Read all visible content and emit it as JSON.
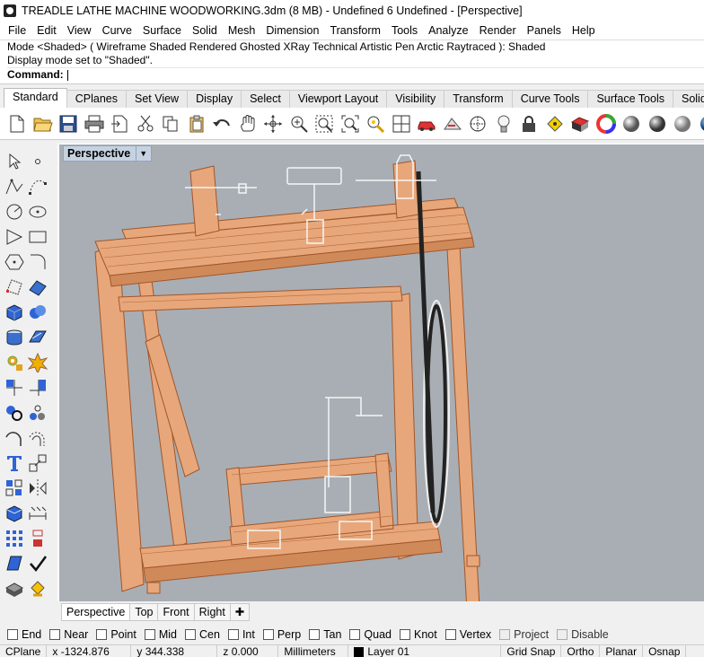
{
  "window": {
    "title": "TREADLE LATHE MACHINE WOODWORKING.3dm (8 MB) - Undefined 6 Undefined - [Perspective]"
  },
  "menu": [
    "File",
    "Edit",
    "View",
    "Curve",
    "Surface",
    "Solid",
    "Mesh",
    "Dimension",
    "Transform",
    "Tools",
    "Analyze",
    "Render",
    "Panels",
    "Help"
  ],
  "command_history": {
    "line1": "Mode <Shaded> ( Wireframe  Shaded  Rendered  Ghosted  XRay  Technical  Artistic  Pen  Arctic  Raytraced ): Shaded",
    "line2": "Display mode set to \"Shaded\".",
    "prompt_label": "Command:",
    "prompt_value": ""
  },
  "toolbar_tabs": [
    "Standard",
    "CPlanes",
    "Set View",
    "Display",
    "Select",
    "Viewport Layout",
    "Visibility",
    "Transform",
    "Curve Tools",
    "Surface Tools",
    "Solid To"
  ],
  "toolbar_tabs_active": "Standard",
  "toolbar_icons": [
    "new-icon",
    "open-icon",
    "save-icon",
    "print-icon",
    "import-icon",
    "cut-icon",
    "copy-icon",
    "paste-icon",
    "undo-icon",
    "pan-icon",
    "rotate-view-icon",
    "zoom-dynamic-icon",
    "zoom-window-icon",
    "zoom-extents-icon",
    "zoom-selected-icon",
    "four-viewports-icon",
    "car-object-icon",
    "named-views-icon",
    "cplane-icon",
    "light-icon",
    "lock-icon",
    "show-hide-icon",
    "materials-icon",
    "color-wheel-icon",
    "render-sphere-icon",
    "shaded-sphere-icon",
    "rendered-sphere-icon",
    "blue-sphere-icon"
  ],
  "left_toolbar_icons": [
    "select-arrow-icon",
    "point-icon",
    "polyline-icon",
    "curve-points-icon",
    "circle-icon",
    "ellipse-icon",
    "arc-icon",
    "rectangle-icon",
    "polygon-icon",
    "fillet-curve-icon",
    "surface-points-icon",
    "surface-edge-icon",
    "box-solid-icon",
    "boolean-union-icon",
    "cylinder-icon",
    "extrude-surface-icon",
    "gear-transform-icon",
    "explode-icon",
    "trim-icon",
    "split-icon",
    "group-icon",
    "points-on-icon",
    "curve-fillet-icon",
    "offset-curve-icon",
    "text-icon",
    "scale-icon",
    "array-icon",
    "mirror-icon",
    "solid-box-icon",
    "dimension-icon",
    "grid-array-icon",
    "block-icon",
    "surface-analysis-icon",
    "check-icon",
    "render-object-icon",
    "paint-bucket-icon"
  ],
  "viewport": {
    "label": "Perspective",
    "colors": {
      "background": "#a9aeb4",
      "wood": "#e8a77a",
      "wood_edge": "#a0562a"
    }
  },
  "view_tabs": [
    "Perspective",
    "Top",
    "Front",
    "Right"
  ],
  "view_tabs_active": "Perspective",
  "osnaps": [
    {
      "label": "End",
      "checked": false,
      "disabled": false
    },
    {
      "label": "Near",
      "checked": false,
      "disabled": false
    },
    {
      "label": "Point",
      "checked": false,
      "disabled": false
    },
    {
      "label": "Mid",
      "checked": false,
      "disabled": false
    },
    {
      "label": "Cen",
      "checked": false,
      "disabled": false
    },
    {
      "label": "Int",
      "checked": false,
      "disabled": false
    },
    {
      "label": "Perp",
      "checked": false,
      "disabled": false
    },
    {
      "label": "Tan",
      "checked": false,
      "disabled": false
    },
    {
      "label": "Quad",
      "checked": false,
      "disabled": false
    },
    {
      "label": "Knot",
      "checked": false,
      "disabled": false
    },
    {
      "label": "Vertex",
      "checked": false,
      "disabled": false
    },
    {
      "label": "Project",
      "checked": false,
      "disabled": true
    },
    {
      "label": "Disable",
      "checked": false,
      "disabled": true
    }
  ],
  "status": {
    "cplane": "CPlane",
    "x": "x -1324.876",
    "y": "y 344.338",
    "z": "z 0.000",
    "units": "Millimeters",
    "layer": "Layer 01",
    "grid_snap": "Grid Snap",
    "ortho": "Ortho",
    "planar": "Planar",
    "osnap": "Osnap"
  }
}
